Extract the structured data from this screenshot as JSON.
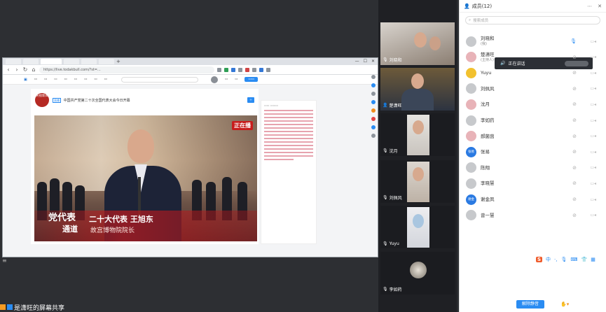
{
  "panel": {
    "title": "成员(12)",
    "search_placeholder": "搜索成员",
    "speaking_label": "正在讲话",
    "mute_all_label": "解除静音",
    "tool_s_label": "S",
    "tool_zh_label": "中",
    "members": [
      {
        "name": "刘晓和",
        "sub": "(我)",
        "mic_on": true
      },
      {
        "name": "楚潇旺",
        "sub": "(主持人)",
        "mic_on": false
      },
      {
        "name": "Yuyu",
        "sub": "",
        "mic_on": false
      },
      {
        "name": "刘佩风",
        "sub": "",
        "mic_on": false
      },
      {
        "name": "沈月",
        "sub": "",
        "mic_on": false
      },
      {
        "name": "李如药",
        "sub": "",
        "mic_on": false
      },
      {
        "name": "郝菌茵",
        "sub": "",
        "mic_on": false
      },
      {
        "name": "张易",
        "sub": "",
        "mic_on": false
      },
      {
        "name": "陈翔",
        "sub": "",
        "mic_on": false
      },
      {
        "name": "李晓慧",
        "sub": "",
        "mic_on": false
      },
      {
        "name": "谢金凤",
        "sub": "",
        "mic_on": false
      },
      {
        "name": "曾一慧",
        "sub": "",
        "mic_on": false
      }
    ],
    "avatar_texts": {
      "zhang": "张易",
      "xie": "谢金"
    }
  },
  "thumbnails": [
    {
      "name": "刘晓和"
    },
    {
      "name": "楚潇旺"
    },
    {
      "name": "沈月"
    },
    {
      "name": "刘佩风"
    },
    {
      "name": "Yuyu"
    },
    {
      "name": "李如药"
    }
  ],
  "browser": {
    "url": "https://live.todakbull.com/?st=..."
  },
  "article": {
    "tag": "直播",
    "title": "中国共产党第二十次全国代表大会今日开幕",
    "channel_logo": "央视新闻"
  },
  "video": {
    "live_logo": "正在播",
    "overlay_party": "党代表",
    "overlay_channel": "通道",
    "overlay_name": "二十大代表 王旭东",
    "overlay_subtitle": "故宫博物院院长"
  },
  "share_tip": "是潇旺的屏幕共享"
}
